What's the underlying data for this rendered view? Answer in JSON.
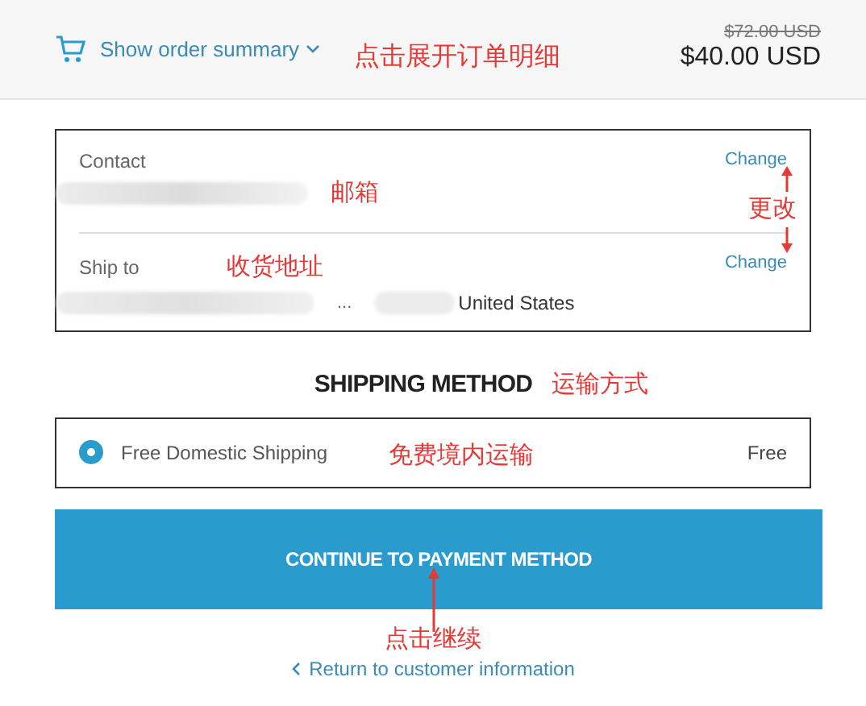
{
  "header": {
    "summary_link": "Show order summary",
    "annotation": "点击展开订单明细",
    "original_price": "$72.00 USD",
    "price": "$40.00 USD"
  },
  "info_card": {
    "rows": [
      {
        "kind": "contact",
        "label": "Contact",
        "link": "Change",
        "annotation": "邮箱"
      },
      {
        "kind": "address",
        "label": "Ship to",
        "link": "Change",
        "annotation": "收货地址",
        "ellipsis": "...",
        "value": "United States"
      }
    ],
    "link_annotation": "更改"
  },
  "shipping_method": {
    "title": "SHIPPING METHOD",
    "annotation": "运输方式",
    "options": [
      {
        "label": "Free Domestic Shipping",
        "price": "Free",
        "selected": true,
        "annotation": "免费境内运输"
      }
    ]
  },
  "continue_button": {
    "label": "CONTINUE TO PAYMENT METHOD",
    "annotation": "点击继续"
  },
  "return_link": "Return to customer information"
}
